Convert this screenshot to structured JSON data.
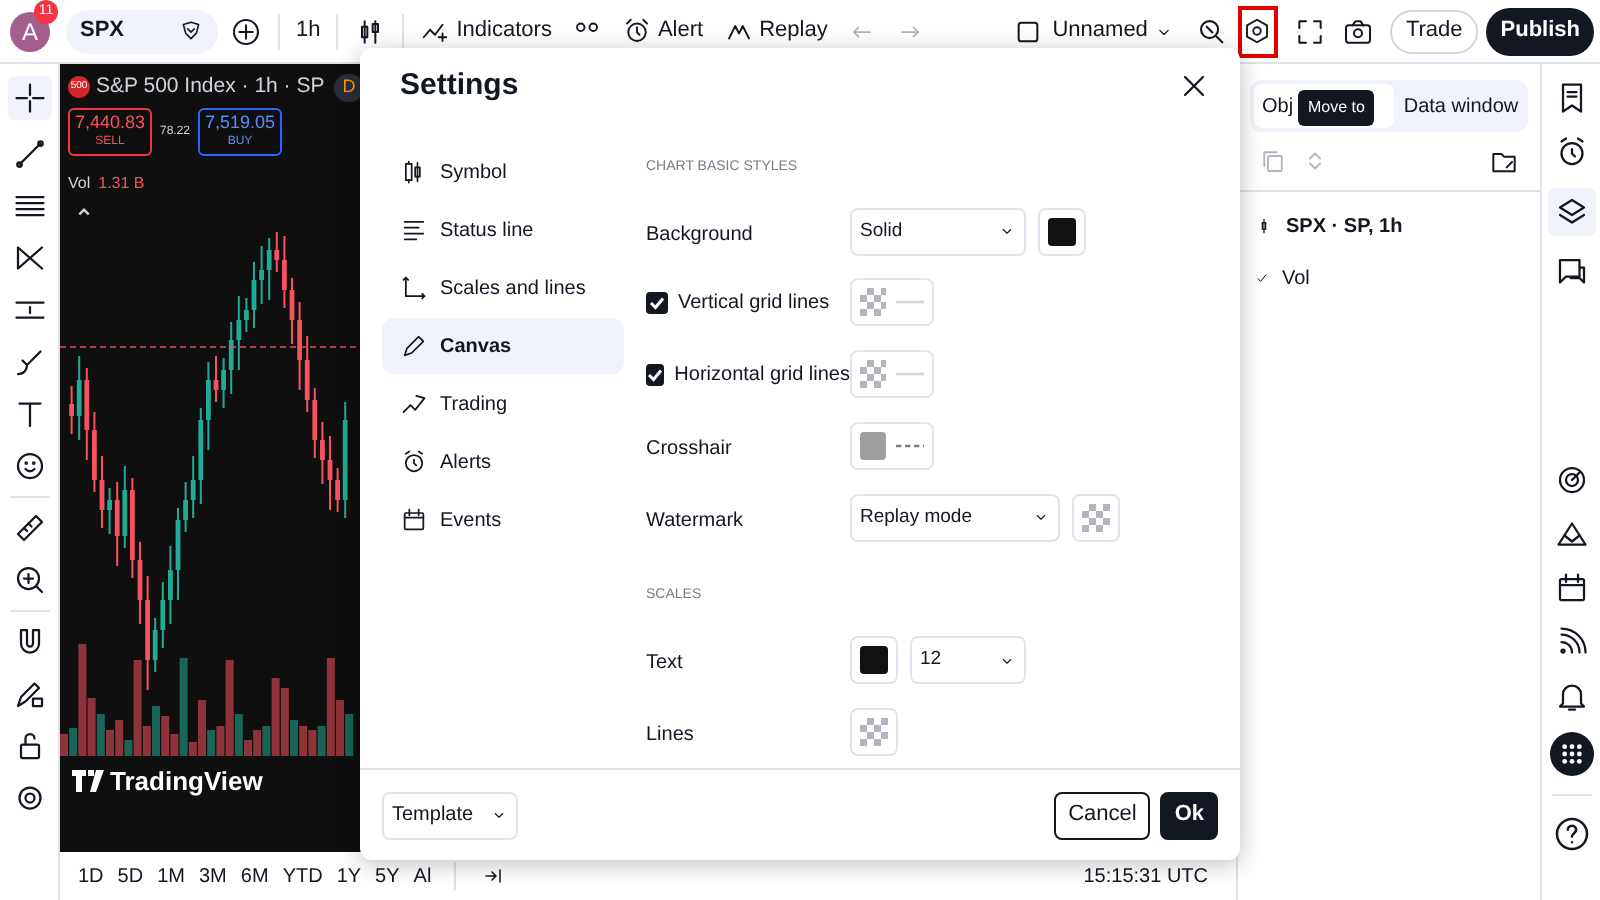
{
  "topbar": {
    "avatar": "A",
    "badge": "11",
    "symbol": "SPX",
    "interval": "1h",
    "buttons": [
      {
        "label": "Indicators"
      },
      {
        "label": "Alert"
      },
      {
        "label": "Replay"
      }
    ],
    "layout_name": "Unnamed",
    "settings_highlighted": true,
    "trade": "Trade",
    "publish": "Publish"
  },
  "chart": {
    "symbol_logo": "500",
    "title": "S&P 500 Index · 1h · SP",
    "badge": "D",
    "sell_price": "7,440.83",
    "sell": "SELL",
    "spread": "78.22",
    "buy_price": "7,519.05",
    "buy": "BUY",
    "volume_label": "Vol",
    "volume": "1.31 B",
    "logo": "TradingView"
  },
  "periods": [
    "1D",
    "5D",
    "1M",
    "3M",
    "6M",
    "YTD",
    "1Y",
    "5Y",
    "Al"
  ],
  "time": "15:15:31 UTC",
  "settings": {
    "title": "Settings",
    "nav": [
      {
        "label": "Symbol",
        "selected": false
      },
      {
        "label": "Status line",
        "selected": false
      },
      {
        "label": "Scales and lines",
        "selected": false
      },
      {
        "label": "Canvas",
        "selected": true
      },
      {
        "label": "Trading",
        "selected": false
      },
      {
        "label": "Alerts",
        "selected": false
      },
      {
        "label": "Events",
        "selected": false
      }
    ],
    "rows": [
      {
        "kind": "heading",
        "label": "CHART BASIC STYLES"
      },
      {
        "kind": "select",
        "label": "Background",
        "value": "Solid",
        "swatch": {
          "color": "#111111"
        }
      },
      {
        "kind": "checkbox",
        "label": "Vertical grid lines",
        "checked": true,
        "swatch": {
          "transparent": true,
          "line": true
        }
      },
      {
        "kind": "checkbox",
        "label": "Horizontal grid lines",
        "checked": true,
        "swatch": {
          "transparent": true,
          "line": true
        }
      },
      {
        "kind": "plain",
        "label": "Crosshair",
        "swatch": {
          "color": "#9e9e9e",
          "line": true,
          "dashed": true
        }
      },
      {
        "kind": "select",
        "label": "Watermark",
        "value": "Replay mode",
        "swatch": {
          "transparent": true
        }
      },
      {
        "kind": "heading",
        "label": "SCALES"
      },
      {
        "kind": "swatch_select",
        "label": "Text",
        "value": "12",
        "swatch": {
          "color": "#111111"
        }
      },
      {
        "kind": "plain",
        "label": "Lines",
        "swatch": {
          "transparent": true
        }
      }
    ],
    "template": "Template",
    "cancel": "Cancel",
    "ok": "Ok"
  },
  "objects_panel": {
    "tabs": [
      {
        "label": "Obj",
        "selected": true
      },
      {
        "label": "Data window",
        "selected": false
      }
    ],
    "tooltip": "Move to",
    "items": [
      {
        "label": "SPX · SP, 1h"
      },
      {
        "label": "Vol"
      }
    ]
  }
}
